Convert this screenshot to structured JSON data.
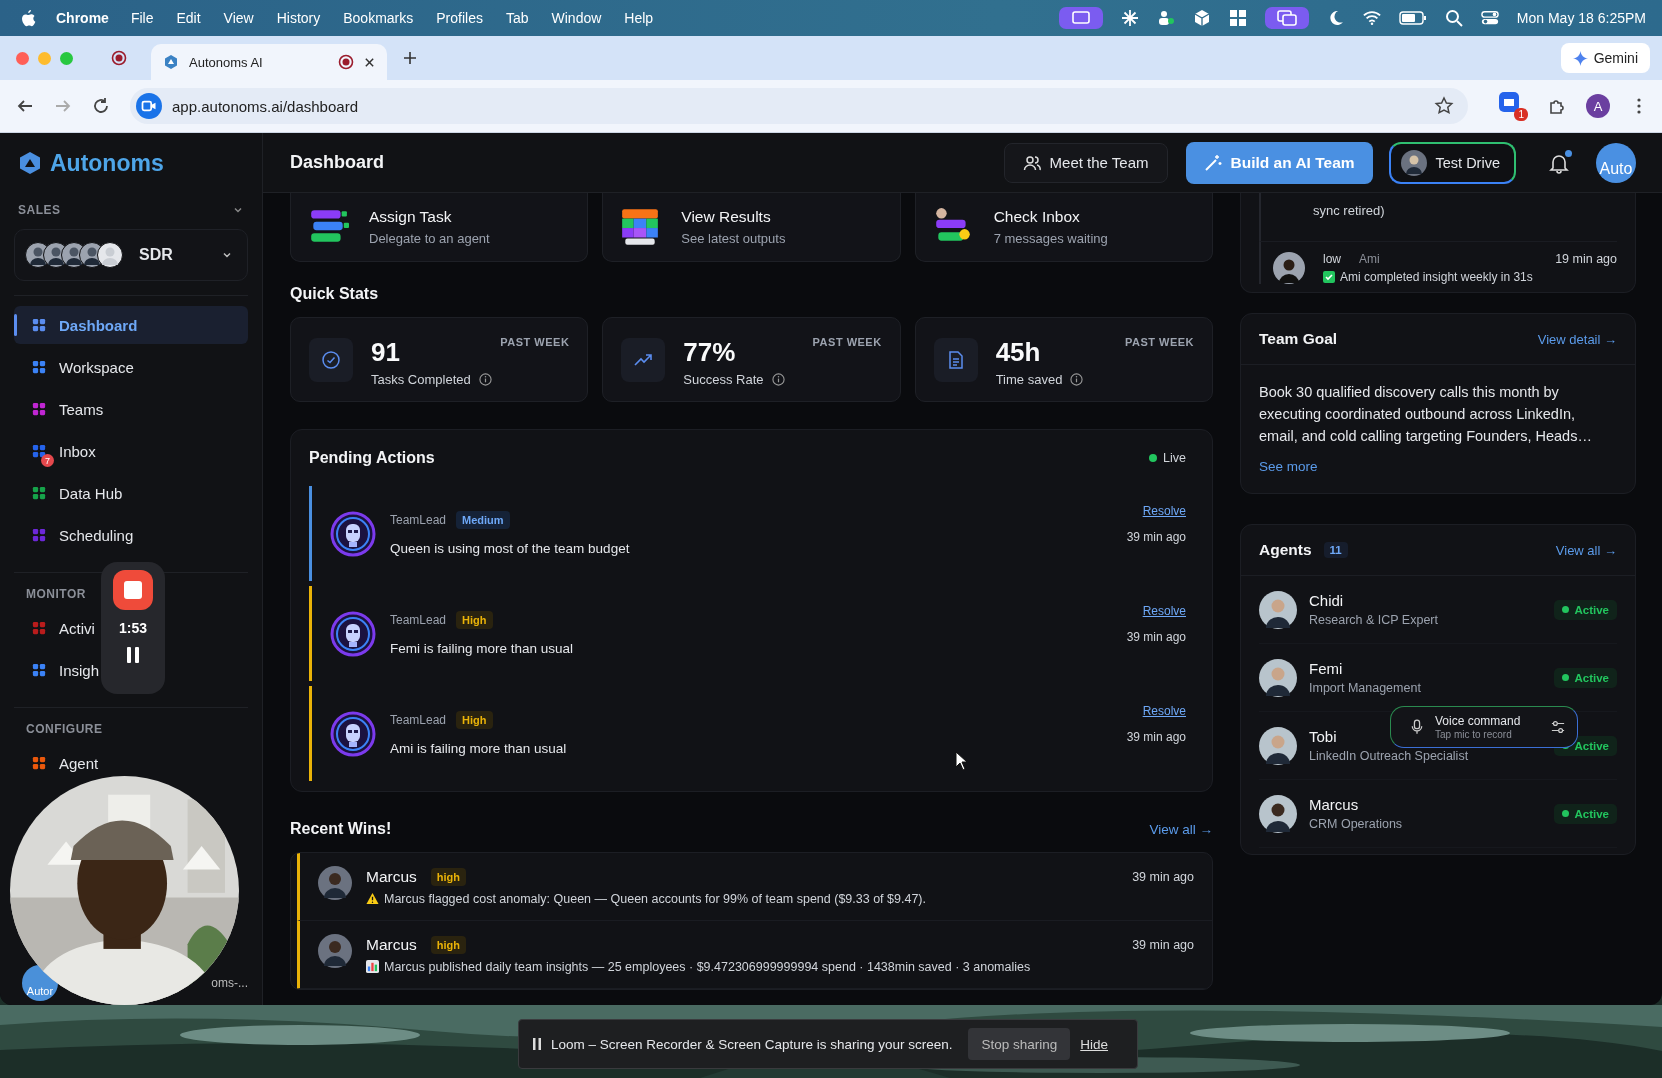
{
  "menubar": {
    "app": "Chrome",
    "menus": [
      "File",
      "Edit",
      "View",
      "History",
      "Bookmarks",
      "Profiles",
      "Tab",
      "Window",
      "Help"
    ],
    "clock": "Mon May 18  6:25PM"
  },
  "browser": {
    "tab_title": "Autonoms AI",
    "recording": true,
    "gemini": "Gemini",
    "url": "app.autonoms.ai/dashboard",
    "extension_badge": "1",
    "profile_initial": "A"
  },
  "sidebar": {
    "brand": "Autonoms",
    "section": "SALES",
    "team": "SDR",
    "items": [
      {
        "label": "Dashboard",
        "selected": true,
        "color": "#5b8def"
      },
      {
        "label": "Workspace",
        "selected": false,
        "color": "#3b82f6"
      },
      {
        "label": "Teams",
        "selected": false,
        "color": "#c026d3"
      },
      {
        "label": "Inbox",
        "selected": false,
        "color": "#2563eb",
        "badge": "7"
      },
      {
        "label": "Data Hub",
        "selected": false,
        "color": "#16a34a"
      },
      {
        "label": "Scheduling",
        "selected": false,
        "color": "#6d28d9"
      }
    ],
    "groups": [
      {
        "title": "MONITOR",
        "items": [
          {
            "label": "Activi",
            "selected": false,
            "color": "#b91c1c"
          },
          {
            "label": "Insigh",
            "selected": false,
            "color": "#3b82f6"
          }
        ]
      },
      {
        "title": "CONFIGURE",
        "items": [
          {
            "label": "Agent",
            "selected": false,
            "color": "#ea580c"
          }
        ]
      }
    ],
    "footer": {
      "avatar_text": "Autor",
      "name": "oms-..."
    }
  },
  "recorder": {
    "time": "1:53"
  },
  "header": {
    "title": "Dashboard",
    "meet": "Meet the Team",
    "build": "Build an AI Team",
    "test_drive": "Test Drive",
    "unread": true,
    "avatar_text": "Auto"
  },
  "quick_actions": [
    {
      "title": "Assign Task",
      "subtitle": "Delegate to an agent"
    },
    {
      "title": "View Results",
      "subtitle": "See latest outputs"
    },
    {
      "title": "Check Inbox",
      "subtitle": "7 messages waiting"
    }
  ],
  "quick_stats": {
    "title": "Quick Stats",
    "items": [
      {
        "value": "91",
        "label": "Tasks Completed",
        "period": "PAST WEEK"
      },
      {
        "value": "77%",
        "label": "Success Rate",
        "period": "PAST WEEK"
      },
      {
        "value": "45h",
        "label": "Time saved",
        "period": "PAST WEEK"
      }
    ]
  },
  "pending": {
    "title": "Pending Actions",
    "status": "Live",
    "items": [
      {
        "agent": "TeamLead",
        "priority": "Medium",
        "kind": "medium",
        "message": "Queen is using most of the team budget",
        "action": "Resolve",
        "time": "39 min ago"
      },
      {
        "agent": "TeamLead",
        "priority": "High",
        "kind": "high",
        "message": "Femi is failing more than usual",
        "action": "Resolve",
        "time": "39 min ago"
      },
      {
        "agent": "TeamLead",
        "priority": "High",
        "kind": "high",
        "message": "Ami is failing more than usual",
        "action": "Resolve",
        "time": "39 min ago"
      }
    ]
  },
  "recent_wins": {
    "title": "Recent Wins!",
    "link": "View all →",
    "items": [
      {
        "name": "Marcus",
        "priority": "high",
        "time": "39 min ago",
        "kind": "warning",
        "message": "Marcus flagged cost anomaly: Queen — Queen accounts for 99% of team spend ($9.33 of $9.47)."
      },
      {
        "name": "Marcus",
        "priority": "high",
        "time": "39 min ago",
        "kind": "chart",
        "message": "Marcus published daily team insights — 25 employees · $9.472306999999994 spend · 1438min saved · 3 anomalies"
      }
    ]
  },
  "activity": {
    "tail": "sync retired)",
    "items": [
      {
        "priority": "low",
        "agent": "Ami",
        "time": "19 min ago",
        "message": "Ami completed insight weekly in 31s"
      }
    ]
  },
  "team_goal": {
    "title": "Team Goal",
    "link": "View detail →",
    "text": "Book 30 qualified discovery calls this month by executing coordinated outbound across LinkedIn, email, and cold calling targeting Founders, Heads…",
    "more": "See more"
  },
  "agents": {
    "title": "Agents",
    "count": "11",
    "link": "View all →",
    "items": [
      {
        "name": "Chidi",
        "role": "Research & ICP Expert",
        "status": "Active",
        "active": true
      },
      {
        "name": "Femi",
        "role": "Import Management",
        "status": "Active",
        "active": true
      },
      {
        "name": "Tobi",
        "role": "LinkedIn Outreach Specialist",
        "status": "Active",
        "active": true
      },
      {
        "name": "Marcus",
        "role": "CRM Operations",
        "status": "Active",
        "active": true
      }
    ]
  },
  "voice": {
    "title": "Voice command",
    "hint": "Tap mic to record"
  },
  "loom": {
    "message": "Loom – Screen Recorder & Screen Capture is sharing your screen.",
    "stop": "Stop sharing",
    "hide": "Hide"
  }
}
